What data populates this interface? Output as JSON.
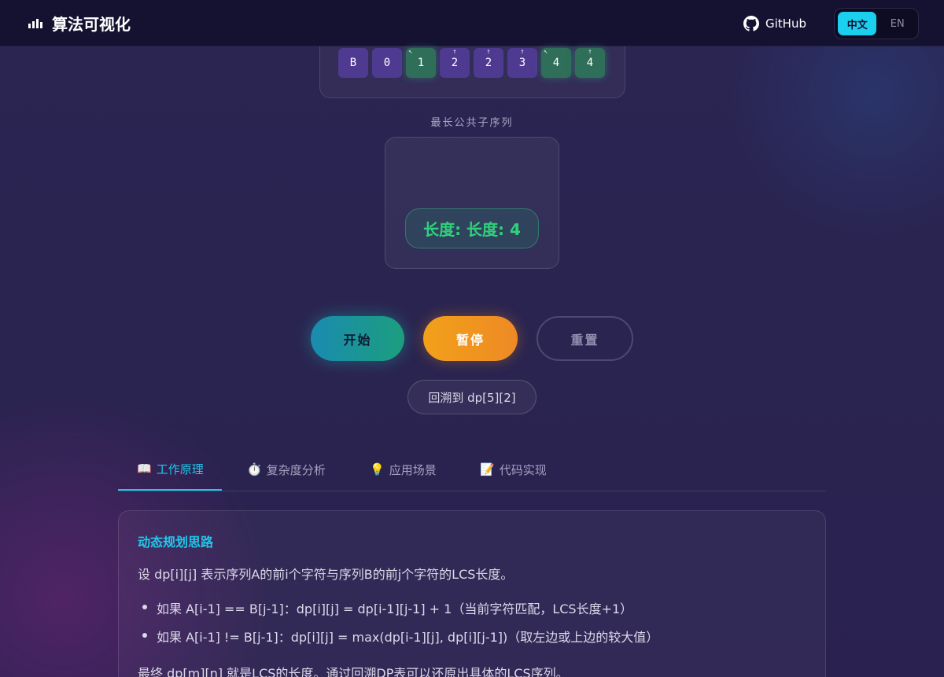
{
  "header": {
    "title": "算法可视化",
    "github_label": "GitHub",
    "lang_options": [
      "中文",
      "EN"
    ],
    "lang_active": "中文"
  },
  "dp_row": {
    "cells": [
      {
        "label": "B",
        "arrow": "",
        "highlight": false
      },
      {
        "label": "0",
        "arrow": "",
        "highlight": false
      },
      {
        "label": "1",
        "arrow": "↖",
        "highlight": true
      },
      {
        "label": "2",
        "arrow": "↑",
        "highlight": false
      },
      {
        "label": "2",
        "arrow": "↑",
        "highlight": false
      },
      {
        "label": "3",
        "arrow": "↑",
        "highlight": false
      },
      {
        "label": "4",
        "arrow": "↖",
        "highlight": true
      },
      {
        "label": "4",
        "arrow": "↑",
        "highlight": true
      }
    ]
  },
  "lcs": {
    "label": "最长公共子序列",
    "length_text": "长度: 长度: 4"
  },
  "controls": {
    "start": "开始",
    "pause": "暂停",
    "reset": "重置",
    "status": "回溯到 dp[5][2]"
  },
  "tabs": [
    {
      "icon": "📖",
      "label": "工作原理",
      "active": true
    },
    {
      "icon": "⏱️",
      "label": "复杂度分析",
      "active": false
    },
    {
      "icon": "💡",
      "label": "应用场景",
      "active": false
    },
    {
      "icon": "📝",
      "label": "代码实现",
      "active": false
    }
  ],
  "content": {
    "heading": "动态规划思路",
    "intro": "设 dp[i][j] 表示序列A的前i个字符与序列B的前j个字符的LCS长度。",
    "bullets": [
      "如果 A[i-1] == B[j-1]：dp[i][j] = dp[i-1][j-1] + 1（当前字符匹配，LCS长度+1）",
      "如果 A[i-1] != B[j-1]：dp[i][j] = max(dp[i-1][j], dp[i][j-1])（取左边或上边的较大值）"
    ],
    "outro": "最终 dp[m][n] 就是LCS的长度。通过回溯DP表可以还原出具体的LCS序列。"
  },
  "colors": {
    "accent": "#1fc8ea",
    "match": "#2ed27b",
    "pause": "#f2a01a"
  }
}
